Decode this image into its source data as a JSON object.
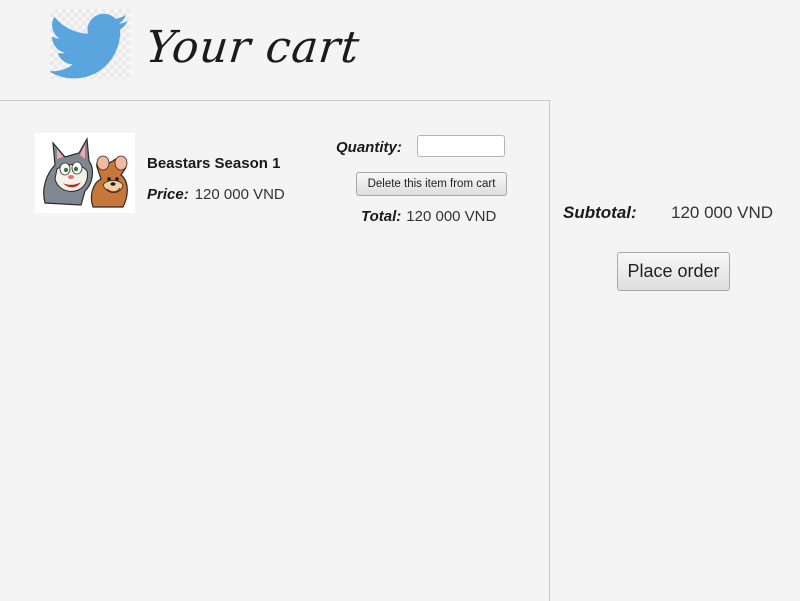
{
  "header": {
    "title": "Your cart",
    "logo_icon": "twitter-bird-icon",
    "logo_color": "#5aa5dd"
  },
  "cart": {
    "items": [
      {
        "thumbnail_icon": "tom-and-jerry-image",
        "name": "Beastars Season 1",
        "price_label": "Price:",
        "price_value": "120 000 VND",
        "quantity_label": "Quantity:",
        "quantity_value": "",
        "delete_label": "Delete this item from cart",
        "total_label": "Total:",
        "total_value": "120 000 VND"
      }
    ]
  },
  "summary": {
    "subtotal_label": "Subtotal:",
    "subtotal_value": "120 000 VND",
    "place_order_label": "Place order"
  }
}
